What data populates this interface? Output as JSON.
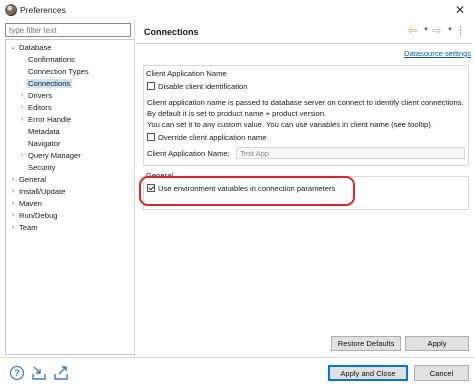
{
  "window": {
    "title": "Preferences",
    "close_glyph": "✕"
  },
  "filter": {
    "placeholder": "type filter text"
  },
  "tree": {
    "items": [
      {
        "label": "Database",
        "level": 0,
        "expanded": true
      },
      {
        "label": "Confirmations",
        "level": 1
      },
      {
        "label": "Connection Types",
        "level": 1
      },
      {
        "label": "Connections",
        "level": 1,
        "selected": true
      },
      {
        "label": "Drivers",
        "level": 1,
        "expandable": true
      },
      {
        "label": "Editors",
        "level": 1,
        "expandable": true
      },
      {
        "label": "Error Handle",
        "level": 1,
        "expandable": true
      },
      {
        "label": "Metadata",
        "level": 1
      },
      {
        "label": "Navigator",
        "level": 1
      },
      {
        "label": "Query Manager",
        "level": 1,
        "expandable": true
      },
      {
        "label": "Security",
        "level": 1
      },
      {
        "label": "General",
        "level": 0,
        "expandable": true
      },
      {
        "label": "Install/Update",
        "level": 0,
        "expandable": true
      },
      {
        "label": "Maven",
        "level": 0,
        "expandable": true
      },
      {
        "label": "Run/Debug",
        "level": 0,
        "expandable": true
      },
      {
        "label": "Team",
        "level": 0,
        "expandable": true
      }
    ]
  },
  "page": {
    "title": "Connections",
    "datasource_link": "Datasource settings",
    "client_group": {
      "label": "Client Application Name",
      "disable_checkbox": "Disable client identification",
      "description": [
        "Client application name is passed to database server on connect to identify client connections.",
        "By default it is set to product name + product version.",
        "You can set it to any custom value. You can use variables in client name (see tooltip)."
      ],
      "override_checkbox": "Override client application name",
      "field_label": "Client Application Name:",
      "field_value": "Test App"
    },
    "general_group": {
      "label": "General",
      "env_checkbox": "Use environment variables in connection parameters",
      "env_checked": true
    },
    "buttons": {
      "restore": "Restore Defaults",
      "apply": "Apply",
      "apply_close": "Apply and Close",
      "cancel": "Cancel"
    }
  },
  "icons": {
    "back": "back-arrow-icon",
    "forward": "forward-arrow-icon",
    "menu": "view-menu-icon",
    "help": "help-icon",
    "import": "import-icon",
    "export": "export-icon"
  },
  "colors": {
    "highlight_ring": "#d8262e",
    "link": "#0b5cad",
    "selection": "#cce4f7",
    "default_button_border": "#0078d7"
  }
}
